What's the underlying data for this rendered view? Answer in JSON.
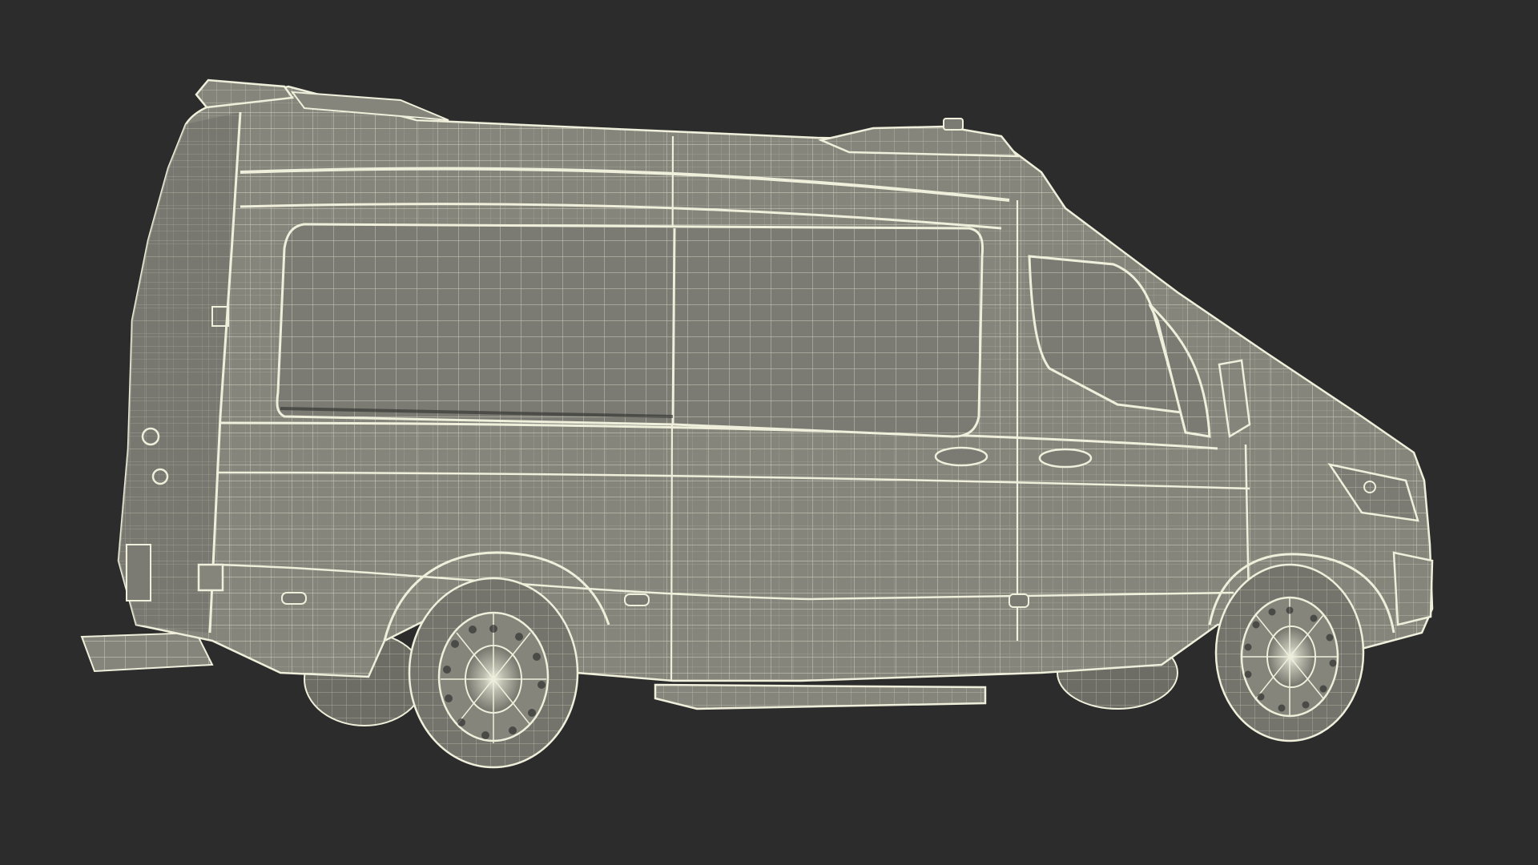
{
  "scene": {
    "subject": "van-wireframe",
    "view": "side-three-quarter",
    "colors": {
      "background": "#2c2c2c",
      "body_fill": "#85857c",
      "body_fill_dark": "#6d6d66",
      "glass_fill": "#7b7b73",
      "wire": "#efefdc",
      "wire_soft": "#d9d9c6",
      "tire_fill": "#74746c",
      "shadow_fill": "#3a3a38"
    }
  }
}
